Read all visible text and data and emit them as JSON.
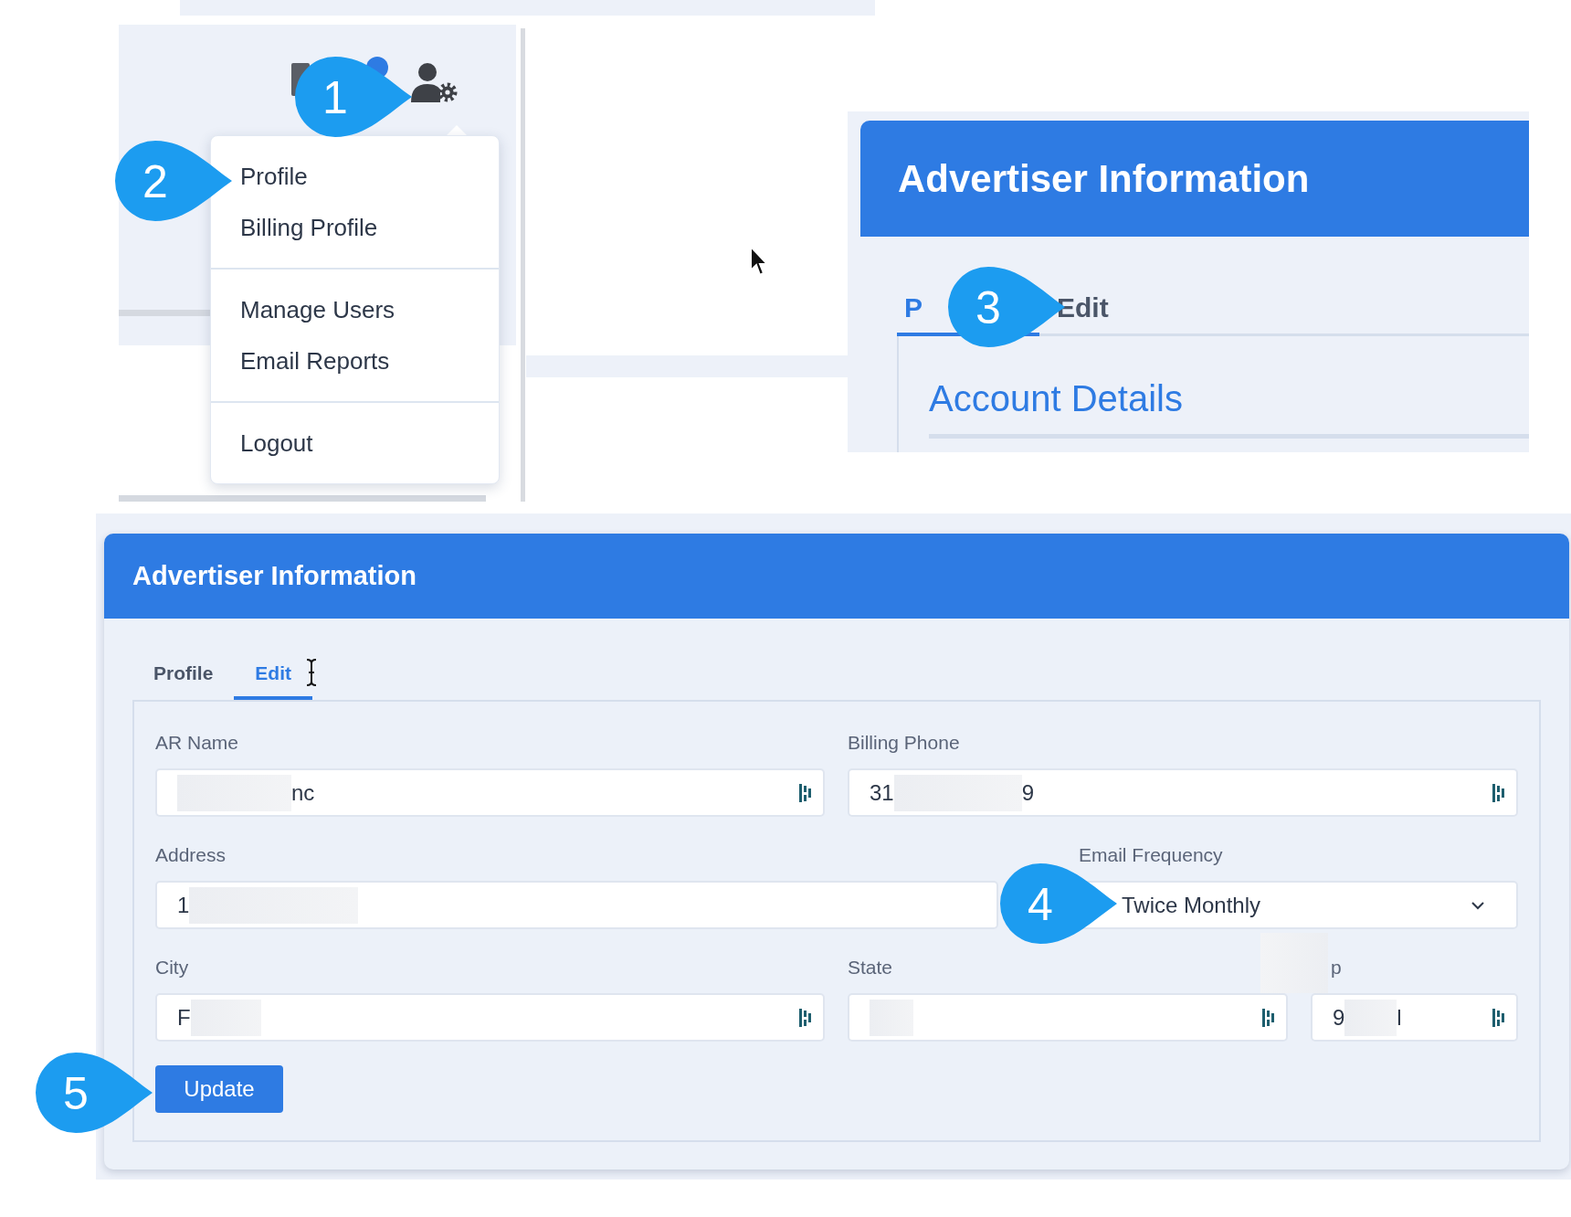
{
  "callouts": [
    {
      "number": "1"
    },
    {
      "number": "2"
    },
    {
      "number": "3"
    },
    {
      "number": "4"
    },
    {
      "number": "5"
    }
  ],
  "menu": {
    "sections": [
      {
        "items": [
          {
            "label": "Profile"
          },
          {
            "label": "Billing Profile"
          }
        ]
      },
      {
        "items": [
          {
            "label": "Manage Users"
          },
          {
            "label": "Email Reports"
          }
        ]
      },
      {
        "items": [
          {
            "label": "Logout"
          }
        ]
      }
    ]
  },
  "preview": {
    "title": "Advertiser Information",
    "tabs": [
      {
        "label": "P",
        "selected": true
      },
      {
        "label": "Edit",
        "selected": false
      }
    ],
    "heading": "Account Details"
  },
  "form": {
    "title": "Advertiser Information",
    "tabs": [
      {
        "label": "Profile",
        "selected": false
      },
      {
        "label": "Edit",
        "selected": true
      }
    ],
    "rows": [
      [
        {
          "label": "AR Name",
          "kind": "text",
          "value_end": "nc",
          "redacted": true,
          "autofill_icon": true
        },
        {
          "label": "Billing Phone",
          "kind": "text",
          "value_start": "31",
          "value_end": "9",
          "redacted": true,
          "autofill_icon": true
        }
      ],
      [
        {
          "label": "Address",
          "kind": "text",
          "value_start": "1",
          "redacted": true,
          "autofill_icon": false
        },
        {
          "label": "Email Frequency",
          "kind": "select",
          "value": "Twice Monthly"
        }
      ],
      [
        {
          "label": "City",
          "kind": "text",
          "value_start": "F",
          "redacted": true,
          "autofill_icon": true
        },
        {
          "label": "State",
          "kind": "text",
          "redacted": true,
          "autofill_icon": true
        },
        {
          "label": "p",
          "label_redacted": true,
          "kind": "text",
          "value_start": "9",
          "value_end": "l",
          "redacted": true,
          "autofill_icon": true
        }
      ]
    ],
    "button": "Update"
  }
}
